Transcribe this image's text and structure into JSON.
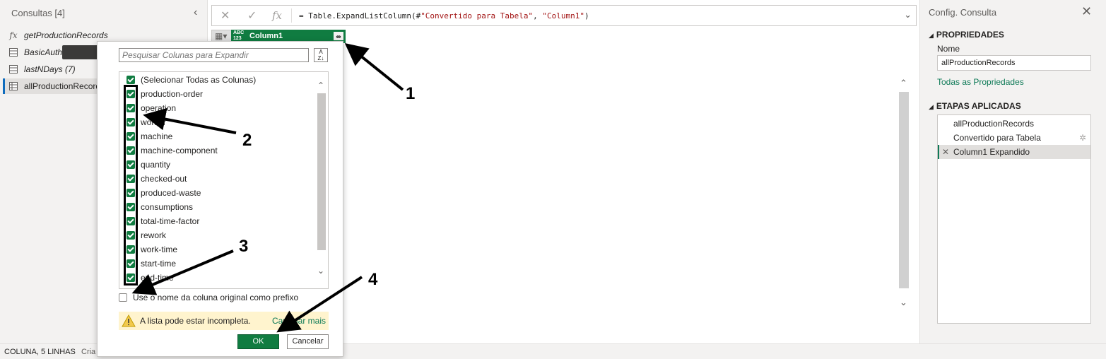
{
  "left_pane": {
    "title": "Consultas [4]",
    "collapse_icon": "chevron-left-icon",
    "queries": [
      {
        "icon": "fx-icon",
        "label": "getProductionRecords"
      },
      {
        "icon": "table-icon",
        "label": "BasicAuth"
      },
      {
        "icon": "table-icon",
        "label": "lastNDays (7)"
      },
      {
        "icon": "table-icon",
        "label": "allProductionRecords"
      }
    ]
  },
  "status_bar": {
    "summary": "COLUNA, 5 LINHAS",
    "truncated": "Cria"
  },
  "formula_bar": {
    "cancel_icon": "close-icon",
    "commit_icon": "check-icon",
    "fx_label": "fx",
    "formula_prefix": "= Table.ExpandListColumn(#",
    "formula_str1": "\"Convertido para Tabela\"",
    "formula_mid": ", ",
    "formula_str2": "\"Column1\"",
    "formula_suffix": ")"
  },
  "grid": {
    "column_type": "ABC\n123",
    "column_name": "Column1",
    "expand_icon": "expand-columns-icon"
  },
  "right_pane": {
    "title": "Config. Consulta",
    "close_icon": "close-icon",
    "properties_heading": "PROPRIEDADES",
    "name_label": "Nome",
    "name_value": "allProductionRecords",
    "all_properties_link": "Todas as Propriedades",
    "steps_heading": "ETAPAS APLICADAS",
    "steps": [
      {
        "label": "allProductionRecords",
        "gear": false,
        "selected": false
      },
      {
        "label": "Convertido para Tabela",
        "gear": true,
        "selected": false
      },
      {
        "label": "Column1 Expandido",
        "gear": false,
        "selected": true
      }
    ]
  },
  "dialog": {
    "search_placeholder": "Pesquisar Colunas para Expandir",
    "sort_icon": "sort-az-icon",
    "select_all_label": "(Selecionar Todas as Colunas)",
    "columns": [
      "production-order",
      "operation",
      "worker",
      "machine",
      "machine-component",
      "quantity",
      "checked-out",
      "produced-waste",
      "consumptions",
      "total-time-factor",
      "rework",
      "work-time",
      "start-time",
      "end-time"
    ],
    "prefix_label": "Use o nome da coluna original como prefixo",
    "prefix_checked": false,
    "warning_text": "A lista pode estar incompleta.",
    "load_more": "Carregar mais",
    "ok_label": "OK",
    "cancel_label": "Cancelar"
  },
  "annotations": [
    "1",
    "2",
    "3",
    "4"
  ]
}
